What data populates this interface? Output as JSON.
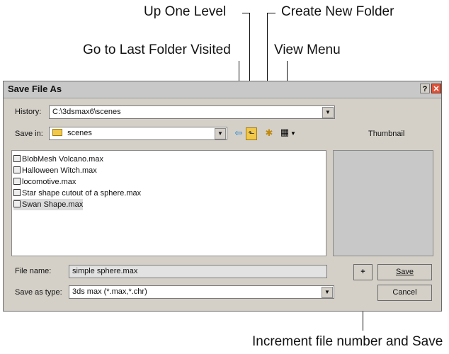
{
  "callouts": {
    "up_one_level": "Up One Level",
    "create_new_folder": "Create New Folder",
    "go_to_last_folder": "Go to Last Folder Visited",
    "view_menu": "View Menu",
    "increment_save": "Increment file number and Save"
  },
  "dialog": {
    "title": "Save File As",
    "help_glyph": "?",
    "close_glyph": "✕",
    "history_label": "History:",
    "history_value": "C:\\3dsmax6\\scenes",
    "save_in_label": "Save in:",
    "save_in_value": "scenes",
    "thumbnail_label": "Thumbnail",
    "files": [
      "BlobMesh Volcano.max",
      "Halloween Witch.max",
      "locomotive.max",
      "Star shape cutout of a sphere.max",
      "Swan Shape.max"
    ],
    "selected_index": 4,
    "file_name_label": "File name:",
    "file_name_value": "simple sphere.max",
    "save_type_label": "Save as type:",
    "save_type_value": "3ds max (*.max,*.chr)",
    "plus_label": "+",
    "save_label": "Save",
    "cancel_label": "Cancel"
  },
  "icons": {
    "back": "⇦",
    "up": "⬑",
    "new_folder": "✱",
    "view": "▦",
    "dropdown": "▼"
  },
  "colors": {
    "dialog_bg": "#d4d0c8",
    "close_button": "#e0533a",
    "folder": "#f2c84b"
  }
}
